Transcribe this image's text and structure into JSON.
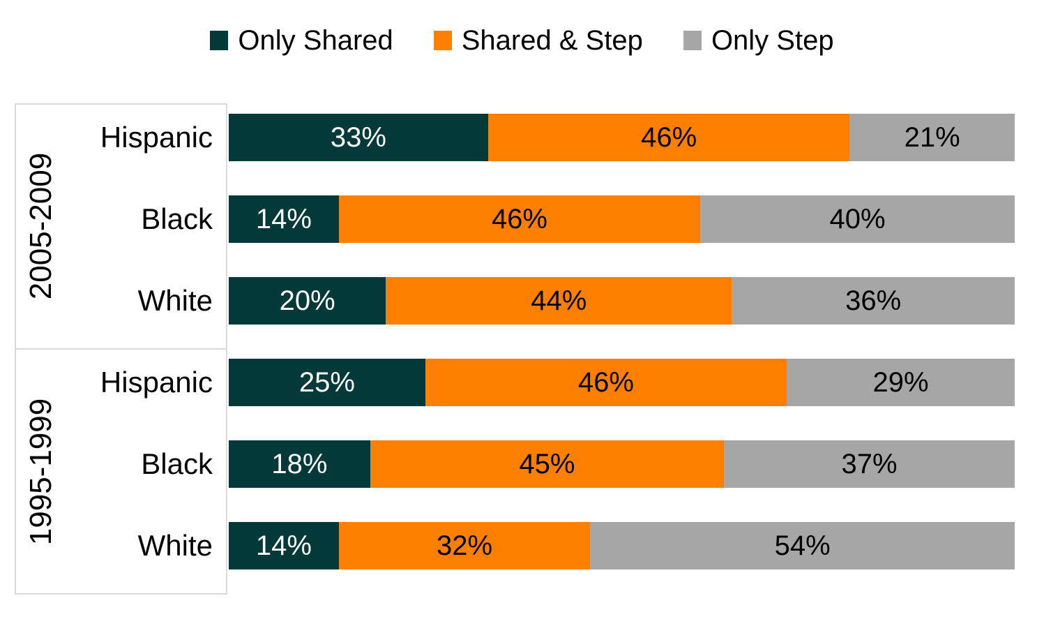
{
  "legend": {
    "items": [
      {
        "label": "Only Shared",
        "color": "#04393A",
        "key": "only_shared"
      },
      {
        "label": "Shared & Step",
        "color": "#FC7F00",
        "key": "shared_and_step"
      },
      {
        "label": "Only Step",
        "color": "#A6A6A6",
        "key": "only_step"
      }
    ]
  },
  "groups": [
    {
      "label": "2005-2009"
    },
    {
      "label": "1995-1999"
    }
  ],
  "rows": [
    {
      "group": "2005-2009",
      "category": "Hispanic",
      "only_shared": "33%",
      "shared_and_step": "46%",
      "only_step": "21%",
      "v_only_shared": 33,
      "v_shared_and_step": 46,
      "v_only_step": 21
    },
    {
      "group": "2005-2009",
      "category": "Black",
      "only_shared": "14%",
      "shared_and_step": "46%",
      "only_step": "40%",
      "v_only_shared": 14,
      "v_shared_and_step": 46,
      "v_only_step": 40
    },
    {
      "group": "2005-2009",
      "category": "White",
      "only_shared": "20%",
      "shared_and_step": "44%",
      "only_step": "36%",
      "v_only_shared": 20,
      "v_shared_and_step": 44,
      "v_only_step": 36
    },
    {
      "group": "1995-1999",
      "category": "Hispanic",
      "only_shared": "25%",
      "shared_and_step": "46%",
      "only_step": "29%",
      "v_only_shared": 25,
      "v_shared_and_step": 46,
      "v_only_step": 29
    },
    {
      "group": "1995-1999",
      "category": "Black",
      "only_shared": "18%",
      "shared_and_step": "45%",
      "only_step": "37%",
      "v_only_shared": 18,
      "v_shared_and_step": 45,
      "v_only_step": 37
    },
    {
      "group": "1995-1999",
      "category": "White",
      "only_shared": "14%",
      "shared_and_step": "32%",
      "only_step": "54%",
      "v_only_shared": 14,
      "v_shared_and_step": 32,
      "v_only_step": 54
    }
  ],
  "chart_data": {
    "type": "bar",
    "title": "",
    "subtitle": "",
    "xlabel": "",
    "ylabel": "",
    "orientation": "horizontal",
    "stacked": true,
    "normalized_percent": true,
    "grid": false,
    "legend_position": "top-center",
    "xlim": [
      0,
      100
    ],
    "categories": [
      "2005-2009 Hispanic",
      "2005-2009 Black",
      "2005-2009 White",
      "1995-1999 Hispanic",
      "1995-1999 Black",
      "1995-1999 White"
    ],
    "group_labels": [
      "2005-2009",
      "1995-1999"
    ],
    "tick_labels": [
      "Hispanic",
      "Black",
      "White",
      "Hispanic",
      "Black",
      "White"
    ],
    "series": [
      {
        "name": "Only Shared",
        "color": "#04393A",
        "values": [
          33,
          14,
          20,
          25,
          18,
          14
        ],
        "data_labels": [
          "33%",
          "14%",
          "20%",
          "25%",
          "18%",
          "14%"
        ]
      },
      {
        "name": "Shared & Step",
        "color": "#FC7F00",
        "values": [
          46,
          46,
          44,
          46,
          45,
          32
        ],
        "data_labels": [
          "46%",
          "46%",
          "44%",
          "46%",
          "45%",
          "32%"
        ]
      },
      {
        "name": "Only Step",
        "color": "#A6A6A6",
        "values": [
          21,
          40,
          36,
          29,
          37,
          54
        ],
        "data_labels": [
          "21%",
          "40%",
          "36%",
          "29%",
          "37%",
          "54%"
        ]
      }
    ]
  }
}
